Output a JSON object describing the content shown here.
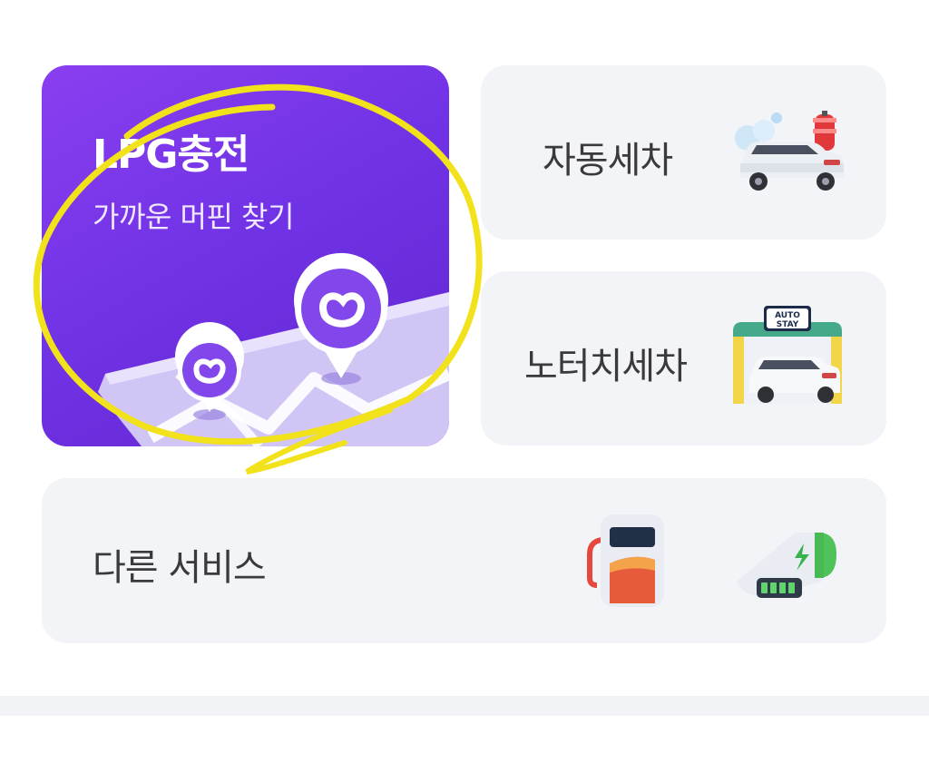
{
  "services": {
    "lpg": {
      "title": "LPG충전",
      "subtitle": "가까운 머핀 찾기",
      "icon": "map-pin-icon",
      "color_start": "#8a3ff0",
      "color_end": "#6126cf"
    },
    "auto_wash": {
      "label": "자동세차",
      "icon": "car-wash-icon"
    },
    "no_touch_wash": {
      "label": "노터치세차",
      "icon": "auto-stay-wash-icon",
      "sign_line1": "AUTO",
      "sign_line2": "STAY"
    },
    "other": {
      "label": "다른 서비스",
      "icons": [
        "fuel-pump-icon",
        "ev-charger-icon"
      ]
    }
  },
  "annotation": {
    "type": "hand-drawn-circle",
    "color": "#f2e21b"
  }
}
